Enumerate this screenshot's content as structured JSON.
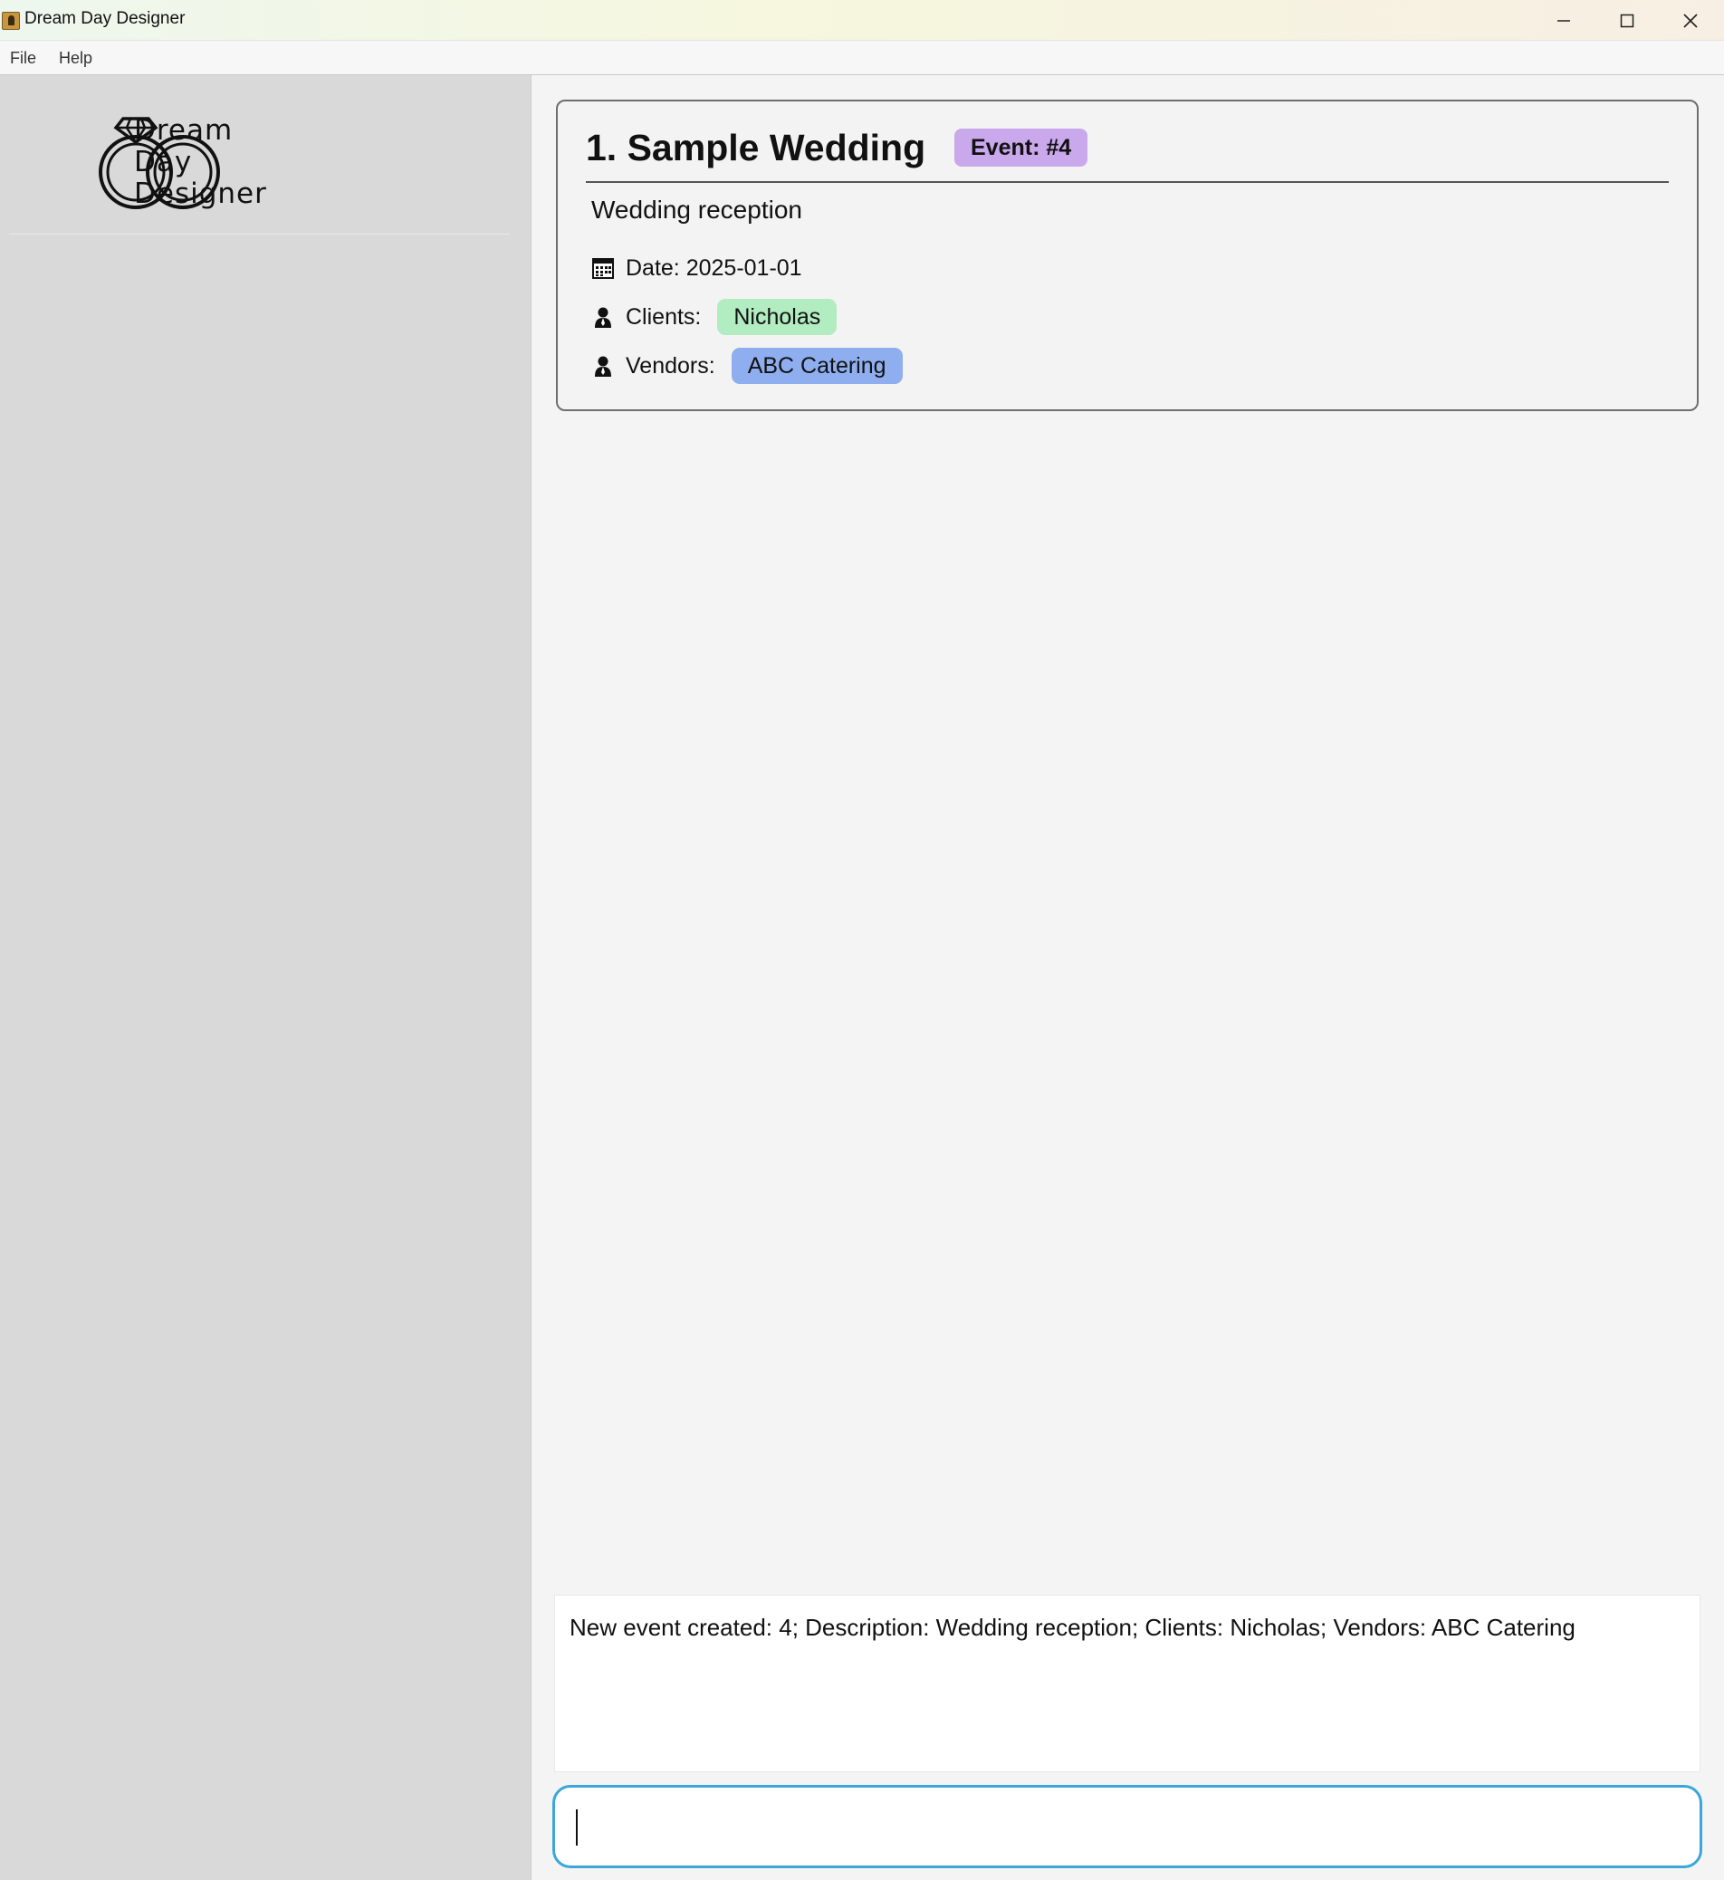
{
  "window": {
    "title": "Dream Day Designer",
    "icons": [
      "app-icon",
      "minimize-icon",
      "maximize-icon",
      "close-icon"
    ]
  },
  "menu": {
    "items": [
      "File",
      "Help"
    ]
  },
  "sidebar": {
    "logo_lines": [
      "Dream",
      "Day",
      "Designer"
    ],
    "logo_icon": "wedding-rings-icon"
  },
  "event_card": {
    "title": "1. Sample Wedding",
    "badge": "Event: #4",
    "description": "Wedding reception",
    "date_label": "Date: 2025-01-01",
    "clients_label": "Clients:",
    "clients": [
      "Nicholas"
    ],
    "vendors_label": "Vendors:",
    "vendors": [
      "ABC Catering"
    ],
    "colors": {
      "badge": "#c9a8ec",
      "client_tag": "#b2ecc1",
      "vendor_tag": "#8eaef0"
    },
    "icons": [
      "calendar-icon",
      "person-icon"
    ]
  },
  "result": {
    "message": "New event created: 4; Description: Wedding reception; Clients: Nicholas; Vendors: ABC Catering"
  },
  "command": {
    "value": "",
    "focus_color": "#3aa7d8"
  }
}
